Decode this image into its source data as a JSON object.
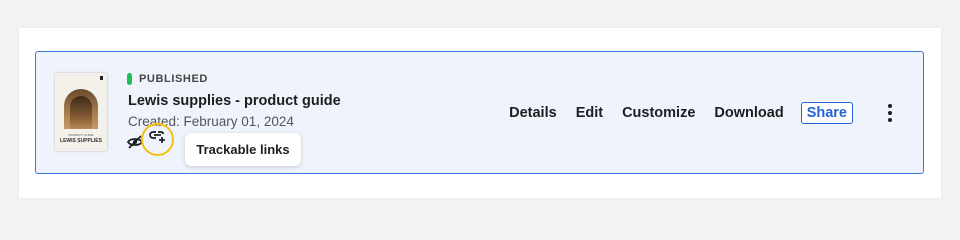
{
  "document": {
    "status": "PUBLISHED",
    "status_color": "#1fbf55",
    "title": "Lewis supplies - product guide",
    "created": "Created: February 01, 2024",
    "thumbnail": {
      "small_text": "PRODUCT GUIDE",
      "brand": "LEWIS SUPPLIES"
    }
  },
  "icons": {
    "visibility": "eye-off-icon",
    "trackable": "link-add-icon",
    "menu": "more-vertical-icon"
  },
  "tooltip": {
    "text": "Trackable links"
  },
  "actions": {
    "details": "Details",
    "edit": "Edit",
    "customize": "Customize",
    "download": "Download",
    "share": "Share"
  },
  "colors": {
    "accent": "#2563d9",
    "card_background": "#eef3fc",
    "highlight": "#f2c012"
  }
}
